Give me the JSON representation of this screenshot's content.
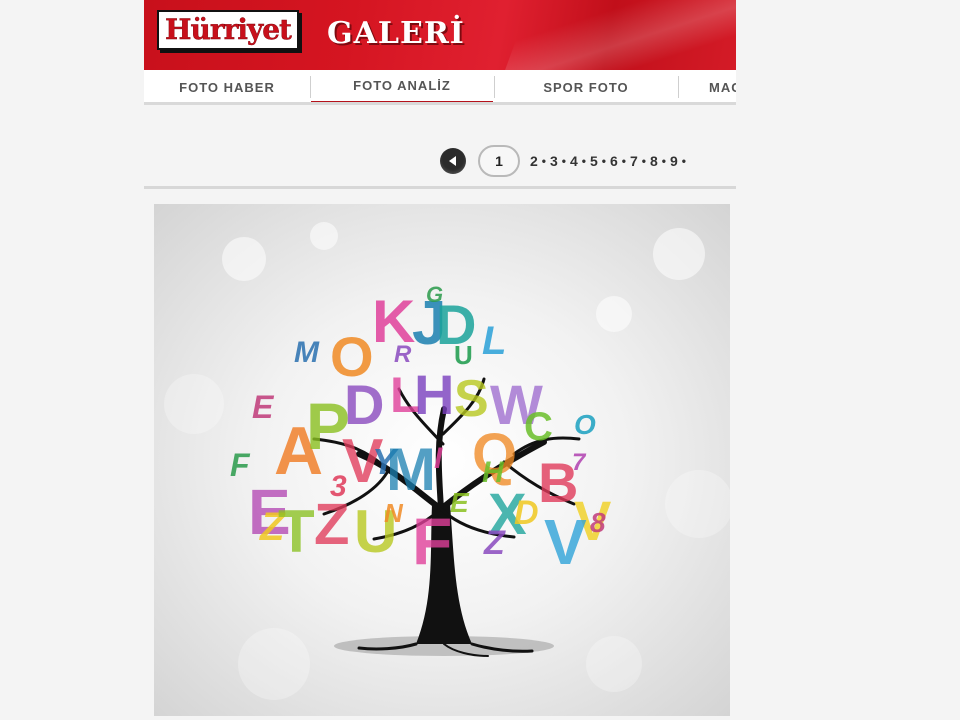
{
  "header": {
    "logo": "Hürriyet",
    "section_title": "GALERİ"
  },
  "nav": {
    "tabs": [
      {
        "label": "FOTO HABER",
        "active": false
      },
      {
        "label": "FOTO ANALİZ",
        "active": true
      },
      {
        "label": "SPOR FOTO",
        "active": false
      },
      {
        "label": "MAG",
        "active": false
      }
    ]
  },
  "pager": {
    "prev_icon": "triangle-left-icon",
    "current": "1",
    "pages": [
      "2",
      "3",
      "4",
      "5",
      "6",
      "7",
      "8",
      "9"
    ],
    "separator": "•"
  },
  "colors": {
    "brand_red": "#c8101b",
    "active_tab_underline": "#b5121b"
  },
  "photo": {
    "subject": "tree-with-letters-illustration",
    "letters": [
      "K",
      "J",
      "D",
      "L",
      "M",
      "O",
      "G",
      "V",
      "A",
      "Y",
      "H",
      "S",
      "I",
      "W",
      "C",
      "E",
      "P",
      "N",
      "B",
      "R",
      "F",
      "Z",
      "U",
      "X",
      "T",
      "Q"
    ]
  }
}
